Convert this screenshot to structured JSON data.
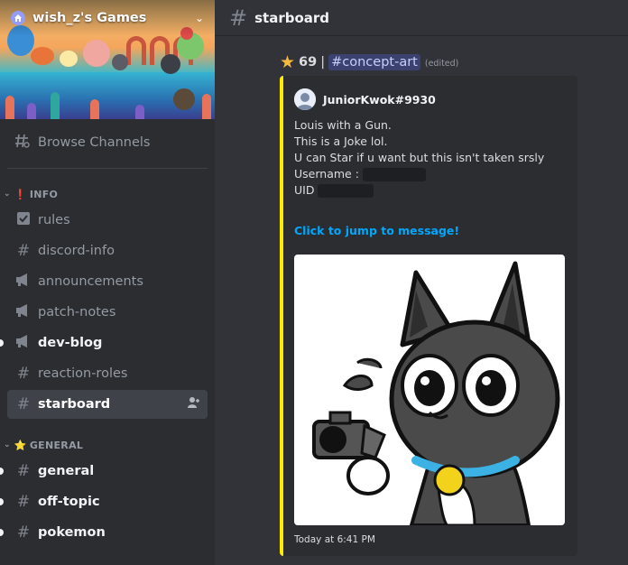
{
  "server": {
    "name": "wish_z's Games"
  },
  "sidebar": {
    "browse_label": "Browse Channels",
    "categories": [
      {
        "label": "INFO",
        "emoji": "❗"
      },
      {
        "label": "GENERAL",
        "emoji": "⭐"
      }
    ],
    "channels": [
      {
        "label": "rules"
      },
      {
        "label": "discord-info"
      },
      {
        "label": "announcements"
      },
      {
        "label": "patch-notes"
      },
      {
        "label": "dev-blog"
      },
      {
        "label": "reaction-roles"
      },
      {
        "label": "starboard"
      },
      {
        "label": "general"
      },
      {
        "label": "off-topic"
      },
      {
        "label": "pokemon"
      }
    ]
  },
  "header": {
    "channel_name": "starboard"
  },
  "message": {
    "star_count": "69",
    "separator": "|",
    "channel_mention": "#concept-art",
    "edited": "(edited)",
    "embed": {
      "author": "JuniorKwok#9930",
      "lines": [
        "Louis with a Gun.",
        "This is a Joke lol.",
        "U can Star if u want but this isn't taken srsly",
        "Username :",
        "UID"
      ],
      "jump_link": "Click to jump to message!",
      "timestamp": "Today at 6:41 PM",
      "accent_color": "#ffea00"
    }
  }
}
